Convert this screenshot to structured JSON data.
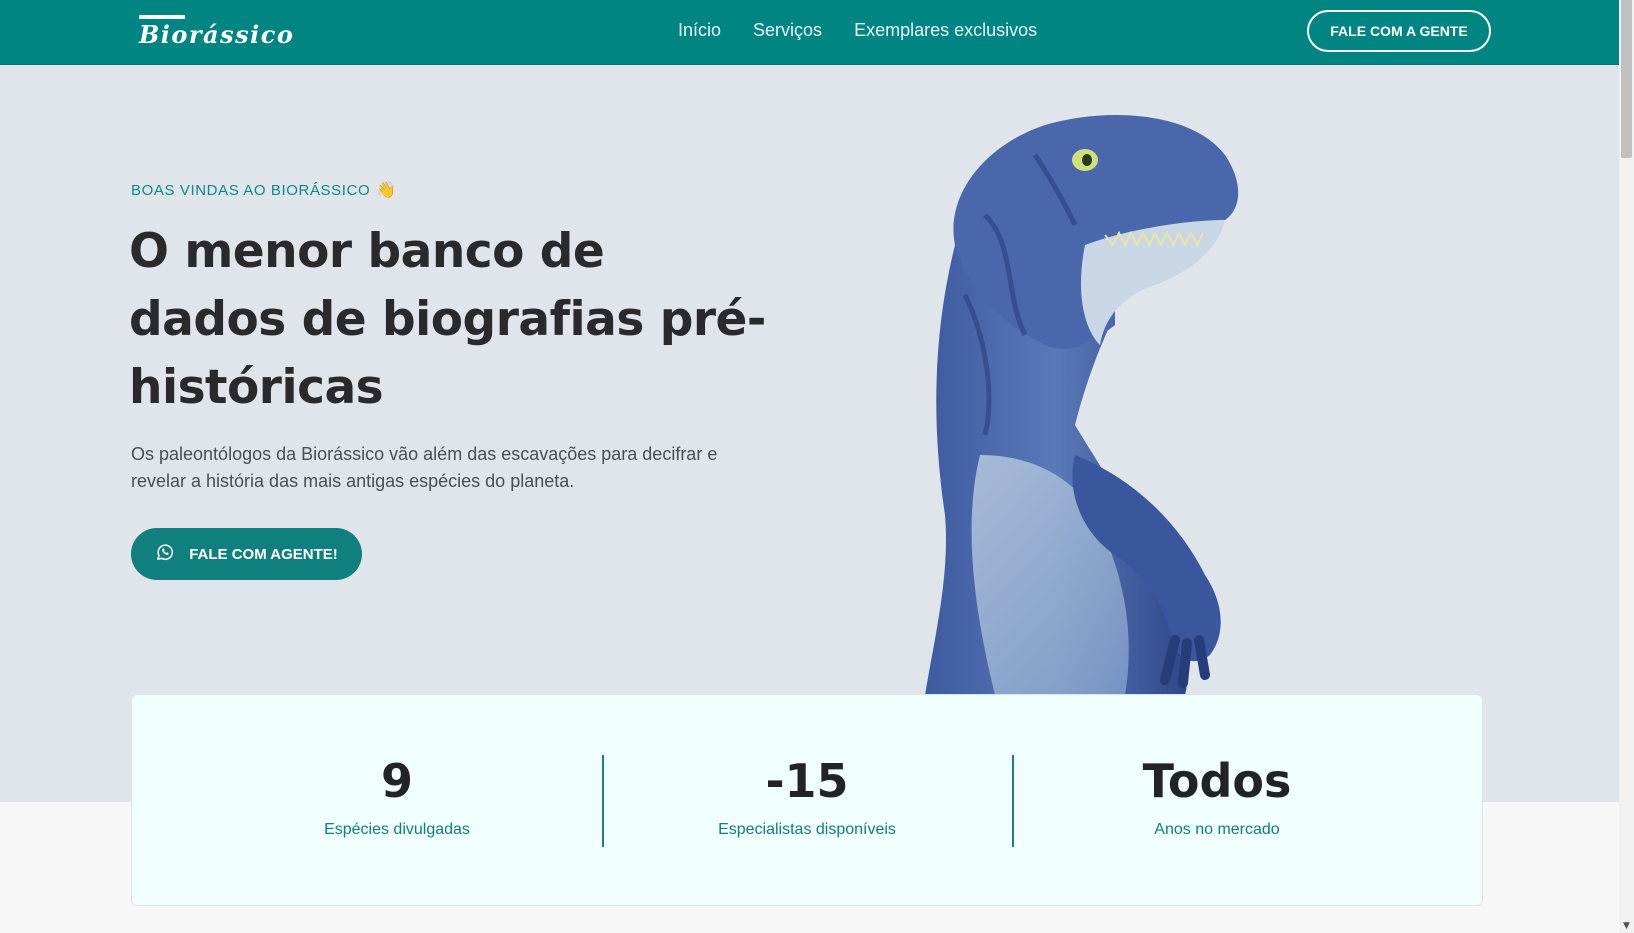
{
  "header": {
    "logo": "Biorássico",
    "nav": [
      "Início",
      "Serviços",
      "Exemplares exclusivos"
    ],
    "cta": "FALE COM A GENTE"
  },
  "hero": {
    "eyebrow": "BOAS VINDAS AO BIORÁSSICO",
    "eyebrow_emoji": "👋",
    "headline": "O menor banco de dados de biografias pré-históricas",
    "lead": "Os paleontólogos da Biorássico vão além das escavações para decifrar e revelar a história das mais antigas espécies do planeta.",
    "cta": "FALE COM AGENTE!",
    "cta_icon": "whatsapp-icon",
    "image_alt": "inflatable-dinosaur-costume"
  },
  "stats": [
    {
      "value": "9",
      "label": "Espécies divulgadas"
    },
    {
      "value": "-15",
      "label": "Especialistas disponíveis"
    },
    {
      "value": "Todos",
      "label": "Anos no mercado"
    }
  ],
  "colors": {
    "brand": "#008583",
    "hero_bg": "#dfe5ea",
    "stats_bg": "#f0fffd",
    "accent_text": "#137d7b"
  }
}
